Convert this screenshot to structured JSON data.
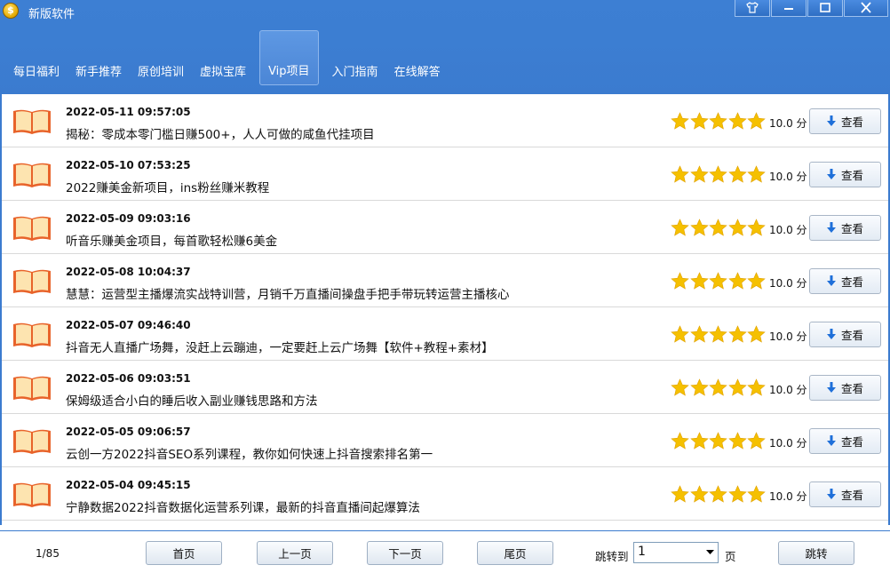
{
  "app": {
    "title": "新版软件"
  },
  "tabs": [
    {
      "label": "每日福利",
      "active": false
    },
    {
      "label": "新手推荐",
      "active": false
    },
    {
      "label": "原创培训",
      "active": false
    },
    {
      "label": "虚拟宝库",
      "active": false
    },
    {
      "label": "Vip项目",
      "active": true
    },
    {
      "label": "入门指南",
      "active": false
    },
    {
      "label": "在线解答",
      "active": false
    }
  ],
  "items": [
    {
      "date": "2022-05-11 09:57:05",
      "title": "揭秘：零成本零门槛日赚500+，人人可做的咸鱼代挂项目",
      "rating": 5,
      "score": "10.0 分",
      "button": "查看"
    },
    {
      "date": "2022-05-10 07:53:25",
      "title": "2022赚美金新项目，ins粉丝赚米教程",
      "rating": 5,
      "score": "10.0 分",
      "button": "查看"
    },
    {
      "date": "2022-05-09 09:03:16",
      "title": "听音乐赚美金项目，每首歌轻松赚6美金",
      "rating": 5,
      "score": "10.0 分",
      "button": "查看"
    },
    {
      "date": "2022-05-08 10:04:37",
      "title": "慧慧：运营型主播爆流实战特训营，月销千万直播间操盘手把手带玩转运营主播核心",
      "rating": 5,
      "score": "10.0 分",
      "button": "查看"
    },
    {
      "date": "2022-05-07 09:46:40",
      "title": "抖音无人直播广场舞，没赶上云蹦迪，一定要赶上云广场舞【软件+教程+素材】",
      "rating": 5,
      "score": "10.0 分",
      "button": "查看"
    },
    {
      "date": "2022-05-06 09:03:51",
      "title": "保姆级适合小白的睡后收入副业赚钱思路和方法",
      "rating": 5,
      "score": "10.0 分",
      "button": "查看"
    },
    {
      "date": "2022-05-05 09:06:57",
      "title": "云创一方2022抖音SEO系列课程，教你如何快速上抖音搜索排名第一",
      "rating": 5,
      "score": "10.0 分",
      "button": "查看"
    },
    {
      "date": "2022-05-04 09:45:15",
      "title": "宁静数据2022抖音数据化运营系列课，最新的抖音直播间起爆算法",
      "rating": 5,
      "score": "10.0 分",
      "button": "查看"
    }
  ],
  "pagination": {
    "page_info": "1/85",
    "first": "首页",
    "prev": "上一页",
    "next": "下一页",
    "last": "尾页",
    "jump_label": "跳转到",
    "page_value": "1",
    "page_unit": "页",
    "jump_button": "跳转"
  },
  "colors": {
    "titlebar": "#3c7ed2",
    "star": "#f5c000",
    "book": "#e8632a"
  }
}
